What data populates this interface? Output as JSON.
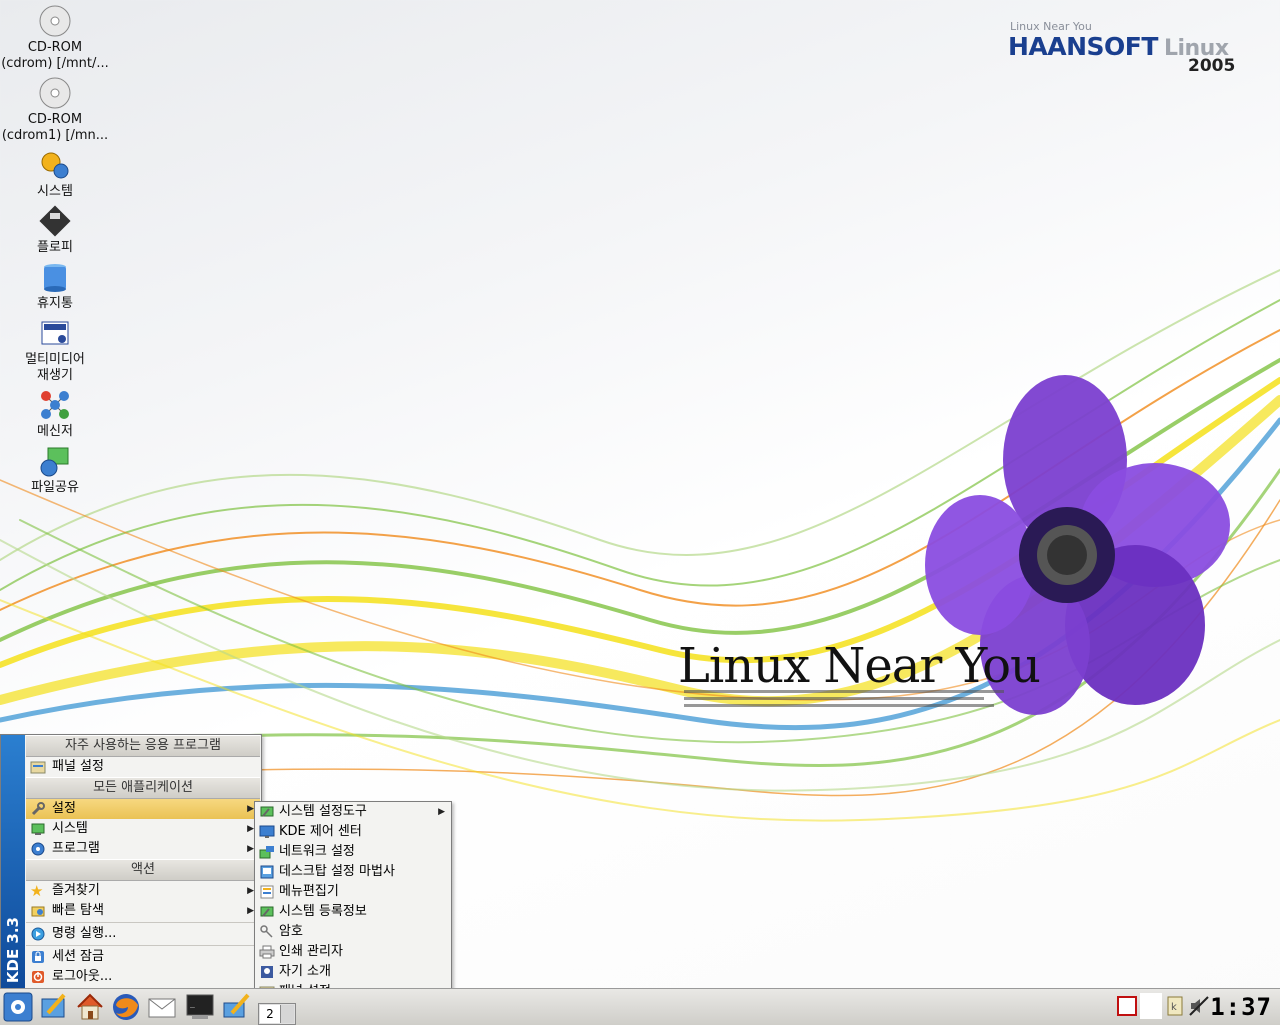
{
  "desktop": {
    "icons": [
      {
        "label1": "CD-ROM",
        "label2": "(cdrom) [/mnt/...",
        "icon": "cdrom-icon"
      },
      {
        "label1": "CD-ROM",
        "label2": "(cdrom1) [/mn...",
        "icon": "cdrom-icon"
      },
      {
        "label1": "시스템",
        "icon": "system-gears-icon"
      },
      {
        "label1": "플로피",
        "icon": "floppy-icon"
      },
      {
        "label1": "휴지통",
        "icon": "trash-icon"
      },
      {
        "label1": "멀티미디어",
        "label2": "재생기",
        "icon": "mplayer-icon"
      },
      {
        "label1": "메신저",
        "icon": "messenger-icon"
      },
      {
        "label1": "파일공유",
        "icon": "file-share-icon"
      }
    ]
  },
  "wallpaper": {
    "logo_sub": "Linux  Near You",
    "logo_main": "HAANSOFT",
    "logo_linux": "Linux",
    "logo_year": "2005",
    "tagline": "Linux Near You"
  },
  "kmenu": {
    "side_label": "KDE 3.3",
    "sections": {
      "frequent": "자주 사용하는 응용 프로그램",
      "all_apps": "모든 애플리케이션",
      "actions": "액션"
    },
    "frequent_items": [
      {
        "label": "패널 설정",
        "icon": "panel-settings-icon"
      }
    ],
    "app_items": [
      {
        "label": "설정",
        "icon": "wrench-icon",
        "submenu": true,
        "selected": true
      },
      {
        "label": "시스템",
        "icon": "system-icon",
        "submenu": true
      },
      {
        "label": "프로그램",
        "icon": "programs-gear-icon",
        "submenu": true
      }
    ],
    "action_items": [
      {
        "label": "즐겨찾기",
        "icon": "star-icon",
        "submenu": true
      },
      {
        "label": "빠른 탐색",
        "icon": "quick-browse-icon",
        "submenu": true
      },
      {
        "label": "명령 실행...",
        "icon": "run-command-icon"
      },
      {
        "label": "세션 잠금",
        "icon": "lock-icon"
      },
      {
        "label": "로그아웃...",
        "icon": "logout-icon"
      }
    ]
  },
  "submenu": {
    "items": [
      {
        "label": "시스템 설정도구",
        "icon": "system-settings-icon",
        "submenu": true
      },
      {
        "label": "KDE 제어 센터",
        "icon": "control-center-icon"
      },
      {
        "label": "네트워크 설정",
        "icon": "network-icon"
      },
      {
        "label": "데스크탑 설정 마법사",
        "icon": "desktop-wizard-icon"
      },
      {
        "label": "메뉴편집기",
        "icon": "menu-editor-icon"
      },
      {
        "label": "시스템 등록정보",
        "icon": "system-info-icon"
      },
      {
        "label": "암호",
        "icon": "password-key-icon"
      },
      {
        "label": "인쇄 관리자",
        "icon": "printer-icon"
      },
      {
        "label": "자기 소개",
        "icon": "about-me-icon"
      },
      {
        "label": "패널 설정",
        "icon": "panel-settings-icon"
      }
    ]
  },
  "taskbar": {
    "pager_desktop": "2",
    "clock": "1:37",
    "launchers": [
      "kmenu-icon",
      "editor-icon",
      "home-icon",
      "firefox-icon",
      "mail-icon",
      "terminal-icon",
      "settings-brush-icon"
    ],
    "tray": [
      "screen-capture-icon",
      "klipper-icon",
      "volume-muted-icon"
    ]
  },
  "colors": {
    "menu_selected": "#eac254",
    "kde_sidebar": "#1f66b8",
    "logo_blue": "#1a3f8f"
  }
}
